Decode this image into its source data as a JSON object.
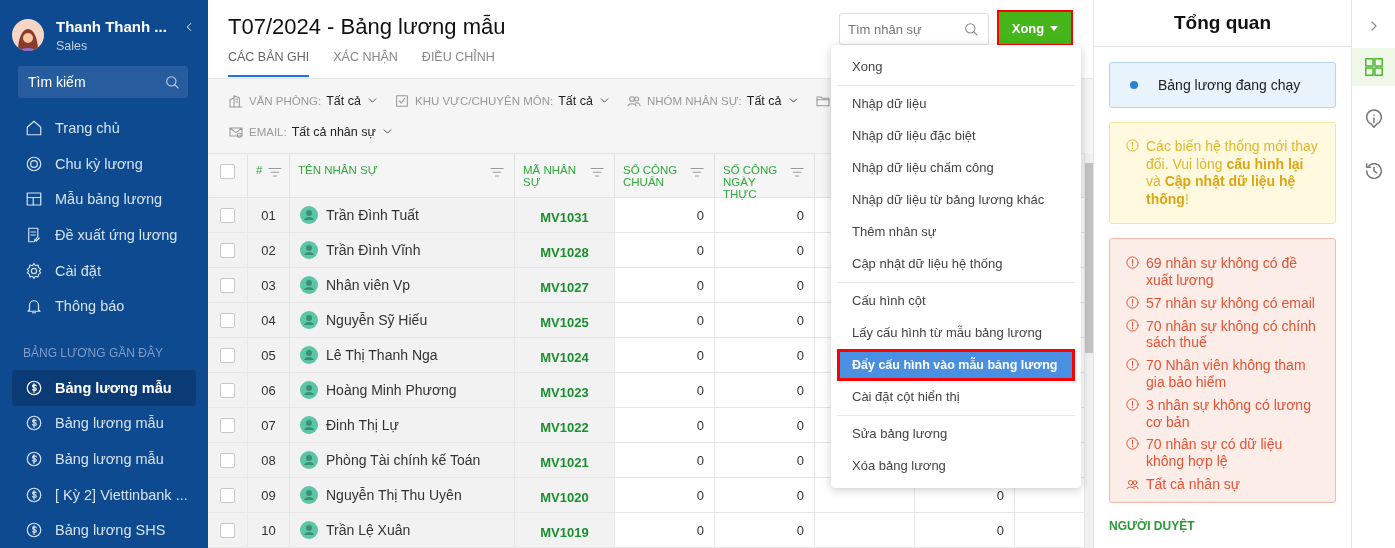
{
  "sidebar": {
    "user": {
      "name": "Thanh Thanh ...",
      "role": "Sales"
    },
    "search": {
      "placeholder": "Tìm kiếm"
    },
    "nav": [
      {
        "label": "Trang chủ"
      },
      {
        "label": "Chu kỳ lương"
      },
      {
        "label": "Mẫu bảng lương"
      },
      {
        "label": "Đề xuất ứng lương"
      },
      {
        "label": "Cài đặt"
      },
      {
        "label": "Thông báo"
      }
    ],
    "recent_title": "BẢNG LƯƠNG GẦN ĐÂY",
    "recent": [
      {
        "label": "Bảng lương mẫu",
        "selected": true
      },
      {
        "label": "Bảng lương mẫu",
        "selected": false
      },
      {
        "label": "Bảng lương mẫu",
        "selected": false
      },
      {
        "label": "[ Kỳ 2] Viettinbank ...",
        "selected": false
      },
      {
        "label": "Bảng lương SHS",
        "selected": false
      }
    ]
  },
  "header": {
    "title": "T07/2024 - Bảng lương mẫu",
    "tabs": [
      {
        "label": "CÁC BẢN GHI",
        "selected": true
      },
      {
        "label": "XÁC NHẬN",
        "selected": false
      },
      {
        "label": "ĐIỀU CHỈNH",
        "selected": false
      }
    ],
    "search": {
      "placeholder": "Tìm nhân sự"
    },
    "done_button": "Xong"
  },
  "filters": [
    {
      "label": "VĂN PHÒNG:",
      "value": "Tất cả"
    },
    {
      "label": "KHU VỰC/CHUYÊN MÔN:",
      "value": "Tất cả"
    },
    {
      "label": "NHÓM NHÂN SỰ:",
      "value": "Tất cả"
    },
    {
      "label": "EMAIL:",
      "value": "Tất cả nhân sự"
    }
  ],
  "table": {
    "select_all_checked": false,
    "columns": [
      "#",
      "TÊN NHÂN SỰ",
      "MÃ NHÂN SỰ",
      "SỐ CÔNG CHUẨN",
      "SỐ CÔNG NGÀY THỰC"
    ],
    "rows": [
      {
        "no": "01",
        "name": "Trần Đình Tuất",
        "code": "MV1031",
        "std": "0",
        "actual": "0",
        "checked": false
      },
      {
        "no": "02",
        "name": "Trần Đình Vĩnh",
        "code": "MV1028",
        "std": "0",
        "actual": "0",
        "checked": false
      },
      {
        "no": "03",
        "name": "Nhân viên Vp",
        "code": "MV1027",
        "std": "0",
        "actual": "0",
        "checked": false
      },
      {
        "no": "04",
        "name": "Nguyễn Sỹ Hiếu",
        "code": "MV1025",
        "std": "0",
        "actual": "0",
        "checked": false
      },
      {
        "no": "05",
        "name": "Lê Thị Thanh Nga",
        "code": "MV1024",
        "std": "0",
        "actual": "0",
        "checked": false
      },
      {
        "no": "06",
        "name": "Hoàng Minh Phương",
        "code": "MV1023",
        "std": "0",
        "actual": "0",
        "checked": false
      },
      {
        "no": "07",
        "name": "Đinh Thị Lự",
        "code": "MV1022",
        "std": "0",
        "actual": "0",
        "checked": false
      },
      {
        "no": "08",
        "name": "Phòng Tài chính kế Toán",
        "code": "MV1021",
        "std": "0",
        "actual": "0",
        "checked": false
      },
      {
        "no": "09",
        "name": "Nguyễn Thị Thu Uyên",
        "code": "MV1020",
        "std": "0",
        "actual": "0",
        "column_6": "0",
        "checked": false
      },
      {
        "no": "10",
        "name": "Trần Lệ Xuân",
        "code": "MV1019",
        "std": "0",
        "actual": "0",
        "column_6": "0",
        "checked": false
      }
    ]
  },
  "menu": [
    [
      {
        "label": "Xong",
        "selected": false
      }
    ],
    [
      {
        "label": "Nhập dữ liệu",
        "selected": false
      },
      {
        "label": "Nhập dữ liệu đặc biệt",
        "selected": false
      },
      {
        "label": "Nhập dữ liệu chấm công",
        "selected": false
      },
      {
        "label": "Nhập dữ liệu từ bảng lương khác",
        "selected": false
      },
      {
        "label": "Thêm nhân sự",
        "selected": false
      },
      {
        "label": "Cập nhật dữ liệu hệ thống",
        "selected": false
      }
    ],
    [
      {
        "label": "Cấu hình cột",
        "selected": false
      },
      {
        "label": "Lấy cấu hình từ mẫu bảng lương",
        "selected": false
      },
      {
        "label": "Đẩy cấu hình vào mẫu bảng lương",
        "selected": true
      },
      {
        "label": "Cài đặt cột hiển thị",
        "selected": false
      }
    ],
    [
      {
        "label": "Sửa bảng lương",
        "selected": false
      },
      {
        "label": "Xóa bảng lương",
        "selected": false
      }
    ]
  ],
  "overview": {
    "title": "Tổng quan",
    "status": "Bảng lương đang chạy",
    "warning": "Các biến hệ thống mới thay đổi. Vui lòng **cấu hình lại** và **Cập nhật dữ liệu hệ thống**!",
    "errors": [
      "69 nhân sự không có đề xuất lương",
      "57 nhân sự không có email",
      "70 nhân sự không có chính sách thuế",
      "70 Nhân viên không tham gia bảo hiểm",
      "3 nhân sự không có lương cơ bản",
      "70 nhân sự có dữ liệu không hợp lệ"
    ],
    "all_staff": "Tất cả nhân sự",
    "approver_title": "NGƯỜI DUYỆT"
  },
  "rail": [
    {
      "selected": true
    },
    {
      "selected": false
    },
    {
      "selected": false
    }
  ]
}
